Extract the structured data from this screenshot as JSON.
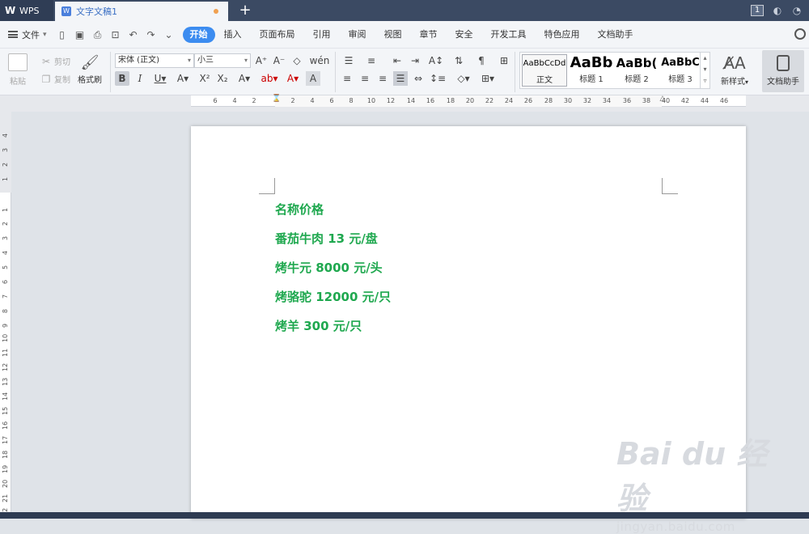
{
  "titlebar": {
    "app_tab": "WPS",
    "doc_tab": "文字文稿1",
    "new_tab_symbol": "+",
    "page_badge": "1"
  },
  "menubar": {
    "file_label": "文件",
    "items": [
      "开始",
      "插入",
      "页面布局",
      "引用",
      "审阅",
      "视图",
      "章节",
      "安全",
      "开发工具",
      "特色应用",
      "文档助手"
    ],
    "active_item": "开始"
  },
  "ribbon": {
    "paste_label": "粘贴",
    "cut_label": "剪切",
    "copy_label": "复制",
    "format_painter_label": "格式刷",
    "font_name": "宋体 (正文)",
    "font_size": "小三",
    "styles": [
      {
        "sample": "AaBbCcDd",
        "name": "正文"
      },
      {
        "sample": "AaBb",
        "name": "标题 1"
      },
      {
        "sample": "AaBb(",
        "name": "标题 2"
      },
      {
        "sample": "AaBbC",
        "name": "标题 3"
      }
    ],
    "new_style_label": "新样式",
    "doc_assistant_label": "文档助手"
  },
  "ruler": {
    "h_ticks": [
      "6",
      "4",
      "2",
      "2",
      "4",
      "6",
      "8",
      "10",
      "12",
      "14",
      "16",
      "18",
      "20",
      "22",
      "24",
      "26",
      "28",
      "30",
      "32",
      "34",
      "36",
      "38",
      "40",
      "42",
      "44",
      "46"
    ],
    "v_ticks": [
      "4",
      "3",
      "2",
      "1",
      "1",
      "2",
      "3",
      "4",
      "5",
      "6",
      "7",
      "8",
      "9",
      "10",
      "11",
      "12",
      "13",
      "14",
      "15",
      "16",
      "17",
      "18",
      "19",
      "20",
      "21",
      "22"
    ]
  },
  "document": {
    "lines": [
      "名称价格",
      "番茄牛肉 13 元/盘",
      "烤牛元 8000 元/头",
      "烤骆驼 12000 元/只",
      "烤羊 300 元/只"
    ],
    "text_color": "#1fa84f"
  },
  "watermark": {
    "logo": "Bai du 经验",
    "url": "jingyan.baidu.com"
  }
}
